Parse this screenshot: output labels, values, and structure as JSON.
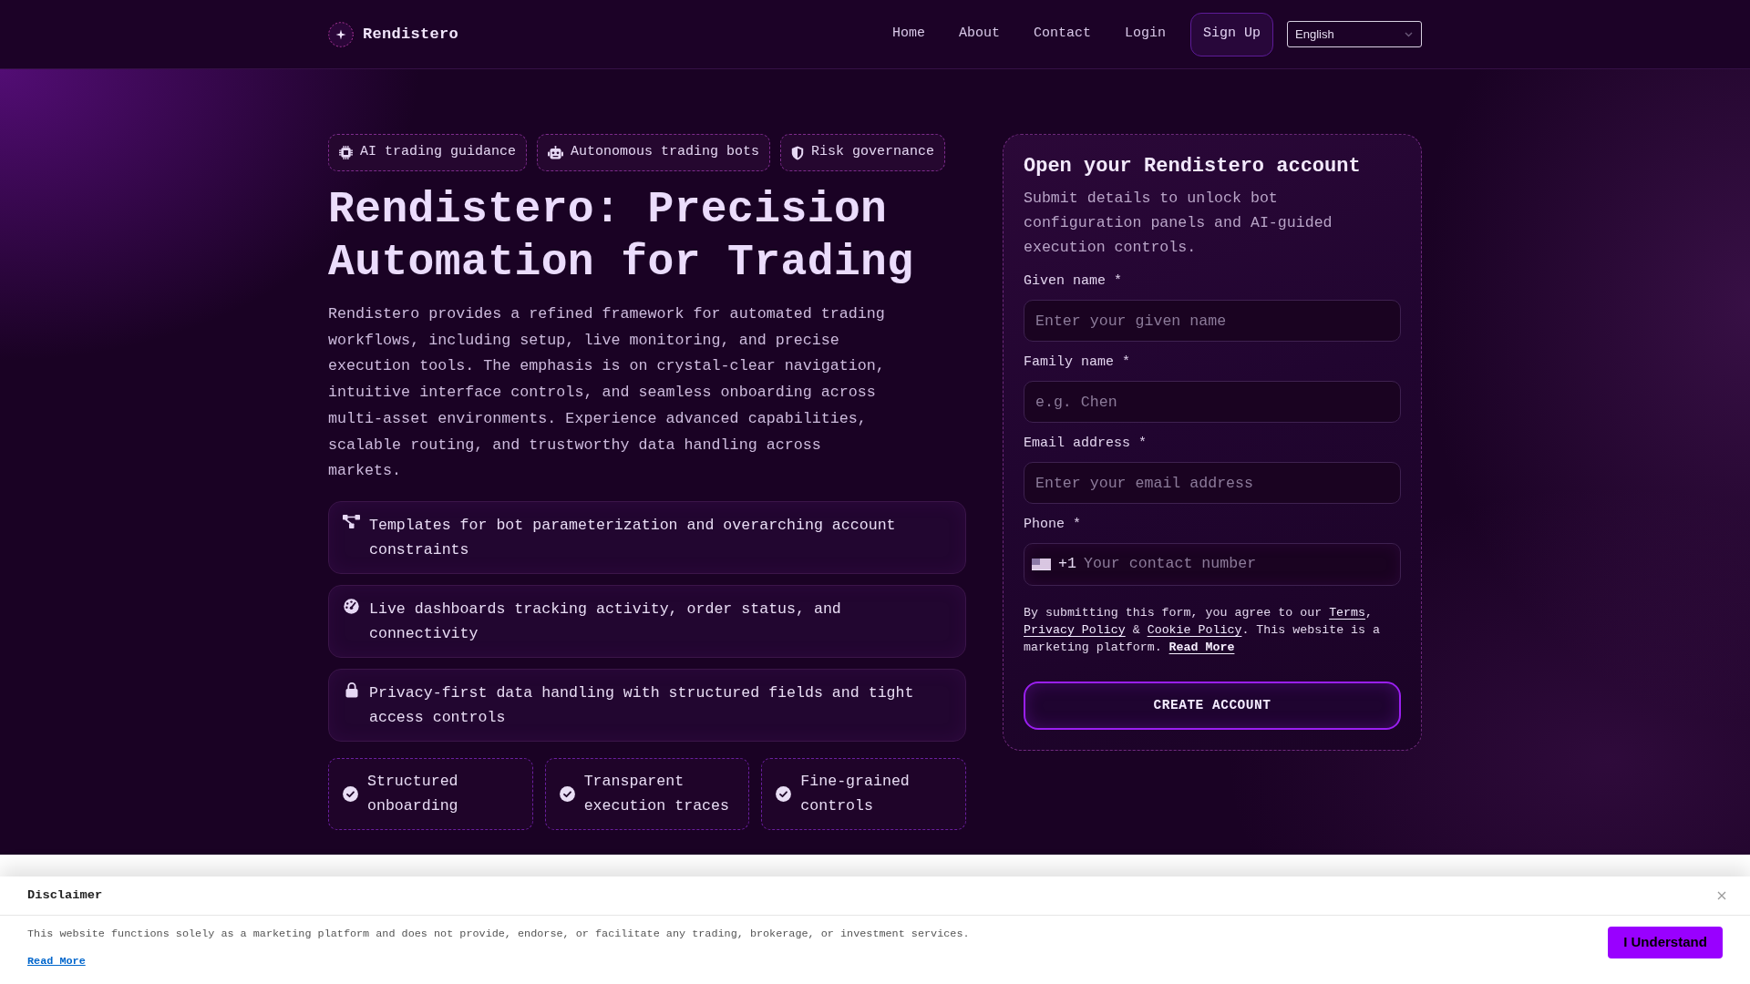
{
  "header": {
    "brand": "Rendistero",
    "nav": [
      {
        "label": "Home"
      },
      {
        "label": "About"
      },
      {
        "label": "Contact"
      },
      {
        "label": "Login"
      }
    ],
    "sign_up": "Sign Up",
    "language": "English"
  },
  "hero": {
    "tags": [
      "AI trading guidance",
      "Autonomous trading bots",
      "Risk governance"
    ],
    "title": "Rendistero: Precision Automation for Trading",
    "description": "Rendistero provides a refined framework for automated trading workflows, including setup, live monitoring, and precise execution tools. The emphasis is on crystal-clear navigation, intuitive interface controls, and seamless onboarding across multi-asset environments. Experience advanced capabilities, scalable routing, and trustworthy data handling across markets.",
    "features": [
      "Templates for bot parameterization and overarching account constraints",
      "Live dashboards tracking activity, order status, and connectivity",
      "Privacy-first data handling with structured fields and tight access controls"
    ],
    "highlights": [
      "Structured onboarding",
      "Transparent execution traces",
      "Fine-grained controls"
    ]
  },
  "signup_form": {
    "title": "Open your Rendistero account",
    "subtitle": "Submit details to unlock bot configuration panels and AI-guided execution controls.",
    "fields": [
      {
        "kind": "text",
        "label": "Given name *",
        "placeholder": "Enter your given name"
      },
      {
        "kind": "text",
        "label": "Family name *",
        "placeholder": "e.g. Chen"
      },
      {
        "kind": "text",
        "label": "Email address *",
        "placeholder": "Enter your email address"
      },
      {
        "kind": "phone",
        "label": "Phone *",
        "dial_code": "+1",
        "placeholder": "Your contact number"
      }
    ],
    "consent": [
      {
        "kind": "text",
        "text": "By submitting this form, you agree to our "
      },
      {
        "kind": "link",
        "text": "Terms"
      },
      {
        "kind": "text",
        "text": ", "
      },
      {
        "kind": "link",
        "text": "Privacy Policy"
      },
      {
        "kind": "text",
        "text": " & "
      },
      {
        "kind": "link",
        "text": "Cookie Policy"
      },
      {
        "kind": "text",
        "text": ". This website is a marketing platform. "
      },
      {
        "kind": "bold_link",
        "text": "Read More"
      }
    ],
    "submit": "CREATE ACCOUNT"
  },
  "disclaimer": {
    "title": "Disclaimer",
    "text": "This website functions solely as a marketing platform and does not provide, endorse, or facilitate any trading, brokerage, or investment services.",
    "link": "Read More",
    "button": "I Understand"
  }
}
